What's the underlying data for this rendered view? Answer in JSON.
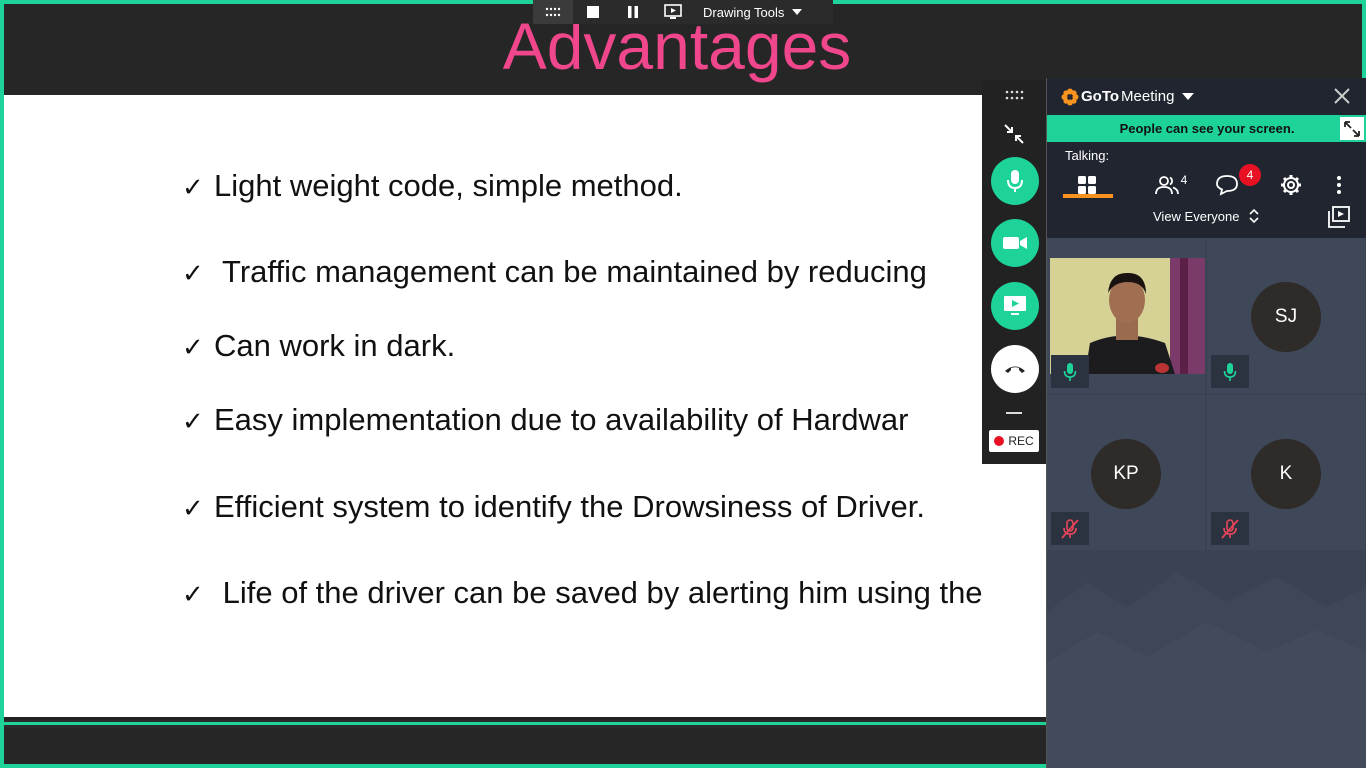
{
  "slide": {
    "title": "Advantages",
    "bullets": [
      {
        "check": "✓",
        "text": "Light weight code, simple method."
      },
      {
        "check": "✓",
        "text": " Traffic management can be maintained by reducing"
      },
      {
        "check": "✓",
        "text": "Can work in dark."
      },
      {
        "check": "✓",
        "text": "Easy implementation due to availability of Hardwar"
      },
      {
        "check": "✓",
        "text": "Efficient system to identify the Drowsiness of Driver."
      },
      {
        "check": "✓",
        "text": " Life of the driver can be saved by alerting him using the"
      }
    ]
  },
  "share_toolbar": {
    "drawing_tools_label": "Drawing Tools"
  },
  "control_bar": {
    "rec_label": "REC"
  },
  "gotomeeting": {
    "brand_goto": "GoTo",
    "brand_meeting": "Meeting",
    "banner_text": "People can see your screen.",
    "talking_label": "Talking:",
    "attendee_count": "4",
    "chat_badge": "4",
    "view_label": "View Everyone",
    "participants": [
      {
        "initials": "",
        "has_video": true,
        "muted": false
      },
      {
        "initials": "SJ",
        "has_video": false,
        "muted": false
      },
      {
        "initials": "KP",
        "has_video": false,
        "muted": true
      },
      {
        "initials": "K",
        "has_video": false,
        "muted": true
      }
    ]
  },
  "colors": {
    "accent_green": "#1ed39a",
    "title_pink": "#f0478c",
    "muted_red": "#e8455a",
    "badge_red": "#e81123",
    "tab_underline": "#f7931e"
  }
}
